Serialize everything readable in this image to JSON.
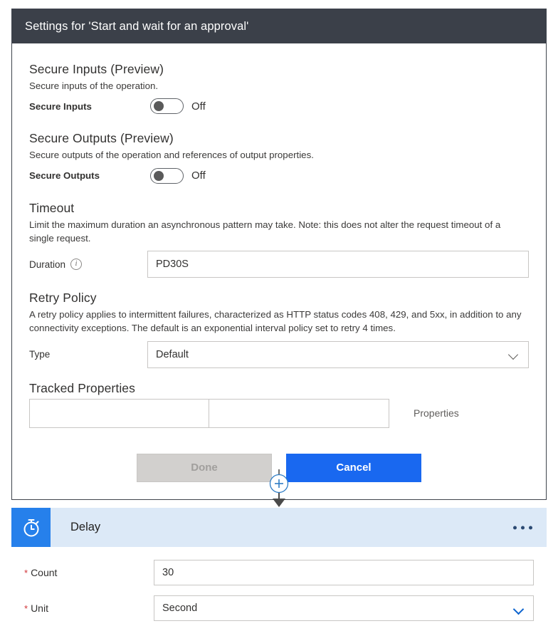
{
  "dialog": {
    "title": "Settings for 'Start and wait for an approval'",
    "sections": {
      "secure_inputs": {
        "title": "Secure Inputs (Preview)",
        "description": "Secure inputs of the operation.",
        "toggle_label": "Secure Inputs",
        "toggle_state": "Off"
      },
      "secure_outputs": {
        "title": "Secure Outputs (Preview)",
        "description": "Secure outputs of the operation and references of output properties.",
        "toggle_label": "Secure Outputs",
        "toggle_state": "Off"
      },
      "timeout": {
        "title": "Timeout",
        "description": "Limit the maximum duration an asynchronous pattern may take. Note: this does not alter the request timeout of a single request.",
        "duration_label": "Duration",
        "duration_value": "PD30S",
        "info_glyph": "i"
      },
      "retry_policy": {
        "title": "Retry Policy",
        "description": "A retry policy applies to intermittent failures, characterized as HTTP status codes 408, 429, and 5xx, in addition to any connectivity exceptions. The default is an exponential interval policy set to retry 4 times.",
        "type_label": "Type",
        "type_value": "Default"
      },
      "tracked_properties": {
        "title": "Tracked Properties",
        "key_value": "",
        "value_value": "",
        "properties_label": "Properties"
      }
    },
    "buttons": {
      "done_label": "Done",
      "cancel_label": "Cancel"
    }
  },
  "connector": {
    "add_icon": "plus-circle-icon",
    "arrow_icon": "arrow-down-icon"
  },
  "delay_card": {
    "icon": "stopwatch-icon",
    "title": "Delay",
    "menu_icon": "ellipsis-icon",
    "fields": [
      {
        "label": "Count",
        "required": true,
        "value": "30",
        "type": "text"
      },
      {
        "label": "Unit",
        "required": true,
        "value": "Second",
        "type": "select"
      }
    ]
  },
  "colors": {
    "header_bar": "#3b4049",
    "accent_blue": "#1968f0",
    "delay_icon_blue": "#2680eb",
    "delay_header_blue": "#dce9f7",
    "required_red": "#d13438",
    "disabled_gray": "#d2d0ce"
  }
}
